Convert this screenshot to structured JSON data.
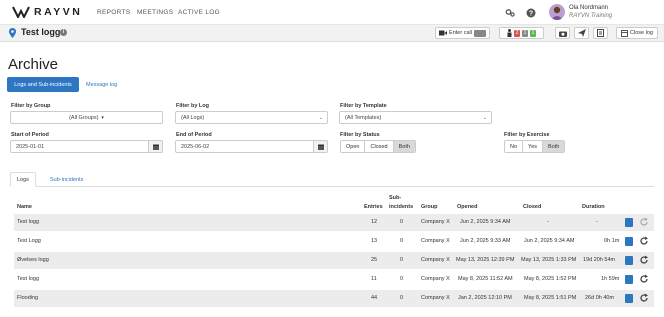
{
  "app": {
    "brand": "RAYVN",
    "nav": [
      "REPORTS",
      "MEETINGS",
      "ACTIVE LOG"
    ],
    "user": {
      "name": "Ola Nordmann",
      "org": "RAYVN Training"
    }
  },
  "logbar": {
    "title": "Test logg",
    "enter_call": "Enter call",
    "counts": [
      "2",
      "1",
      "1"
    ],
    "close_log": "Close log"
  },
  "page": {
    "title": "Archive",
    "tabs": {
      "primary": "Logs and Sub-incidents",
      "secondary": "Message log"
    }
  },
  "filters": {
    "group": {
      "label": "Filter by Group",
      "value": "(All Groups)"
    },
    "log": {
      "label": "Filter by Log",
      "value": "(All Logs)"
    },
    "template": {
      "label": "Filter by Template",
      "value": "(All Templates)"
    },
    "start": {
      "label": "Start of Period",
      "value": "2025-01-01"
    },
    "end": {
      "label": "End of Period",
      "value": "2025-06-02"
    },
    "status": {
      "label": "Filter by Status",
      "options": [
        "Open",
        "Closed",
        "Both"
      ],
      "selected": "Both"
    },
    "exercise": {
      "label": "Filter by Exercise",
      "options": [
        "No",
        "Yes",
        "Both"
      ],
      "selected": "Both"
    }
  },
  "results": {
    "tabs": [
      "Logs",
      "Sub-incidents"
    ],
    "columns": {
      "name": "Name",
      "entries": "Entries",
      "sub1": "Sub-",
      "sub2": "incidents",
      "group": "Group",
      "opened": "Opened",
      "closed": "Closed",
      "duration": "Duration"
    },
    "rows": [
      {
        "name": "Test logg",
        "entries": "12",
        "sub": "0",
        "group": "Company X",
        "opened": "Jun 2, 2025 9:34 AM",
        "closed": "-",
        "duration": "-"
      },
      {
        "name": "Test Logg",
        "entries": "13",
        "sub": "0",
        "group": "Company X",
        "opened": "Jun 2, 2025 9:33 AM",
        "closed": "Jun 2, 2025 9:34 AM",
        "duration": "0h 1m"
      },
      {
        "name": "Øvelses logg",
        "entries": "25",
        "sub": "0",
        "group": "Company X",
        "opened": "May 13, 2025 12:39 PM",
        "closed": "May 13, 2025 1:33 PM",
        "duration": "19d 20h 54m"
      },
      {
        "name": "Test logg",
        "entries": "11",
        "sub": "0",
        "group": "Company X",
        "opened": "May 8, 2025 11:52 AM",
        "closed": "May 8, 2025 1:52 PM",
        "duration": "1h 59m"
      },
      {
        "name": "Flooding",
        "entries": "44",
        "sub": "0",
        "group": "Company X",
        "opened": "Jan 2, 2025 12:10 PM",
        "closed": "May 8, 2025 1:51 PM",
        "duration": "26d 0h 40m"
      }
    ]
  }
}
